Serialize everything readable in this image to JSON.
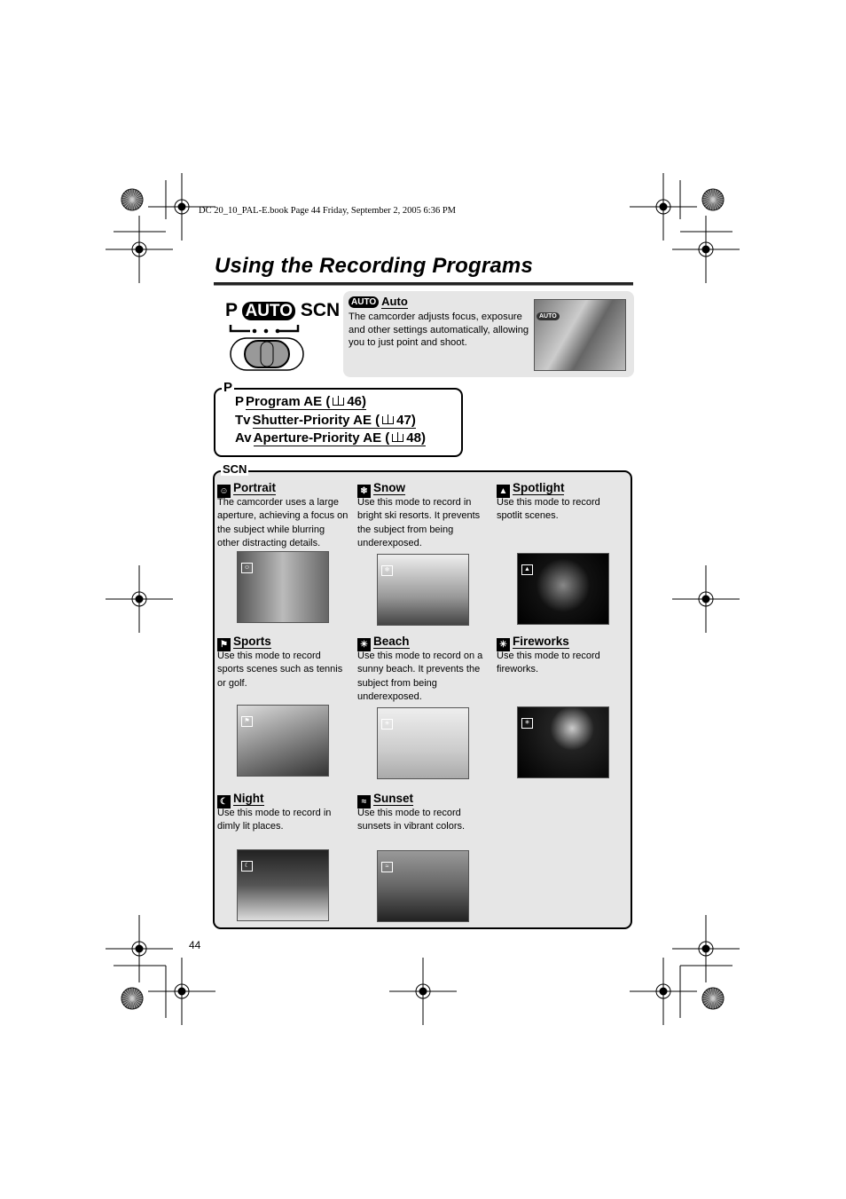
{
  "header": "DC 20_10_PAL-E.book  Page 44  Friday, September 2, 2005  6:36 PM",
  "title": "Using the Recording Programs",
  "dial": {
    "p": "P",
    "auto": "AUTO",
    "scn": "SCN"
  },
  "auto": {
    "badge": "AUTO",
    "title": "Auto",
    "text": "The camcorder adjusts focus, exposure and other settings automatically, allowing you to just point and shoot.",
    "photo_badge": "AUTO"
  },
  "p_section": {
    "label": "P",
    "items": [
      {
        "prefix": "P",
        "label": "Program AE (",
        "page": "46)"
      },
      {
        "prefix": "Tv",
        "label": "Shutter-Priority AE (",
        "page": "47)"
      },
      {
        "prefix": "Av",
        "label": "Aperture-Priority AE (",
        "page": "48)"
      }
    ]
  },
  "scn_section": {
    "label": "SCN",
    "modes": [
      {
        "title": "Portrait",
        "icon": "portrait-icon",
        "text": "The camcorder uses a large aperture, achieving a focus on the subject while blurring other distracting details."
      },
      {
        "title": "Snow",
        "icon": "snow-icon",
        "text": "Use this mode to record in bright ski resorts. It prevents the subject from being underexposed."
      },
      {
        "title": "Spotlight",
        "icon": "spotlight-icon",
        "text": "Use this mode to record spotlit scenes."
      },
      {
        "title": "Sports",
        "icon": "sports-icon",
        "text": "Use this mode to record sports scenes such as tennis or golf."
      },
      {
        "title": "Beach",
        "icon": "beach-icon",
        "text": "Use this mode to record on a sunny beach. It prevents the subject from being underexposed."
      },
      {
        "title": "Fireworks",
        "icon": "fireworks-icon",
        "text": "Use this mode to record fireworks."
      },
      {
        "title": "Night",
        "icon": "night-icon",
        "text": "Use this mode to record in dimly lit places."
      },
      {
        "title": "Sunset",
        "icon": "sunset-icon",
        "text": "Use this mode to record sunsets in vibrant colors."
      }
    ]
  },
  "page_number": "44"
}
